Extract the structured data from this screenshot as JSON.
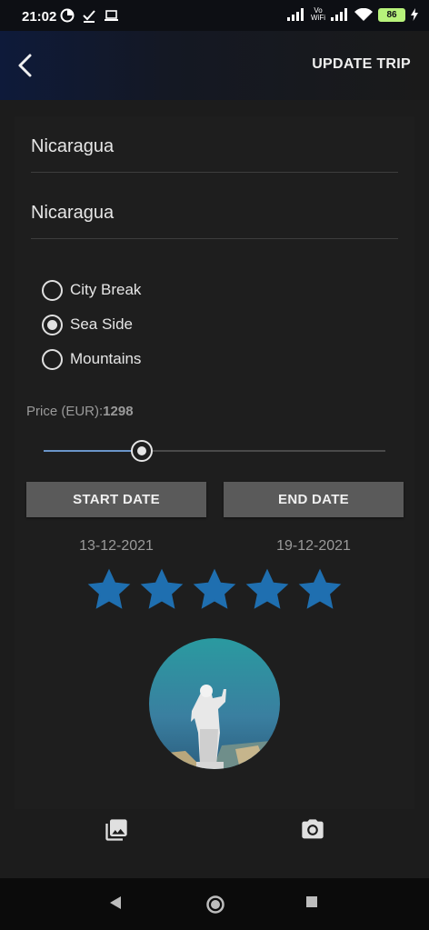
{
  "status_bar": {
    "time": "21:02",
    "vowifi_top": "Vo",
    "vowifi_bottom": "WiFi",
    "battery": "86"
  },
  "app_bar": {
    "back_icon": "arrow-back-icon",
    "action_label": "UPDATE TRIP"
  },
  "form": {
    "trip_name": "Nicaragua",
    "destination": "Nicaragua",
    "trip_types": [
      {
        "label": "City Break",
        "checked": false
      },
      {
        "label": "Sea Side",
        "checked": true
      },
      {
        "label": "Mountains",
        "checked": false
      }
    ],
    "price_label": "Price (EUR):",
    "price_value": "1298",
    "price_fraction": 0.26,
    "start_date_label": "START DATE",
    "end_date_label": "END DATE",
    "start_date": "13-12-2021",
    "end_date": "19-12-2021",
    "rating": 5,
    "rating_max": 5,
    "accent_color": "#1f6fb0",
    "slider_color": "#6a95c9"
  },
  "actions": {
    "gallery_icon": "photo-library-icon",
    "camera_icon": "camera-icon"
  },
  "nav_bar": {
    "back_icon": "nav-back-icon",
    "home_icon": "nav-home-icon",
    "recents_icon": "nav-recents-icon"
  }
}
